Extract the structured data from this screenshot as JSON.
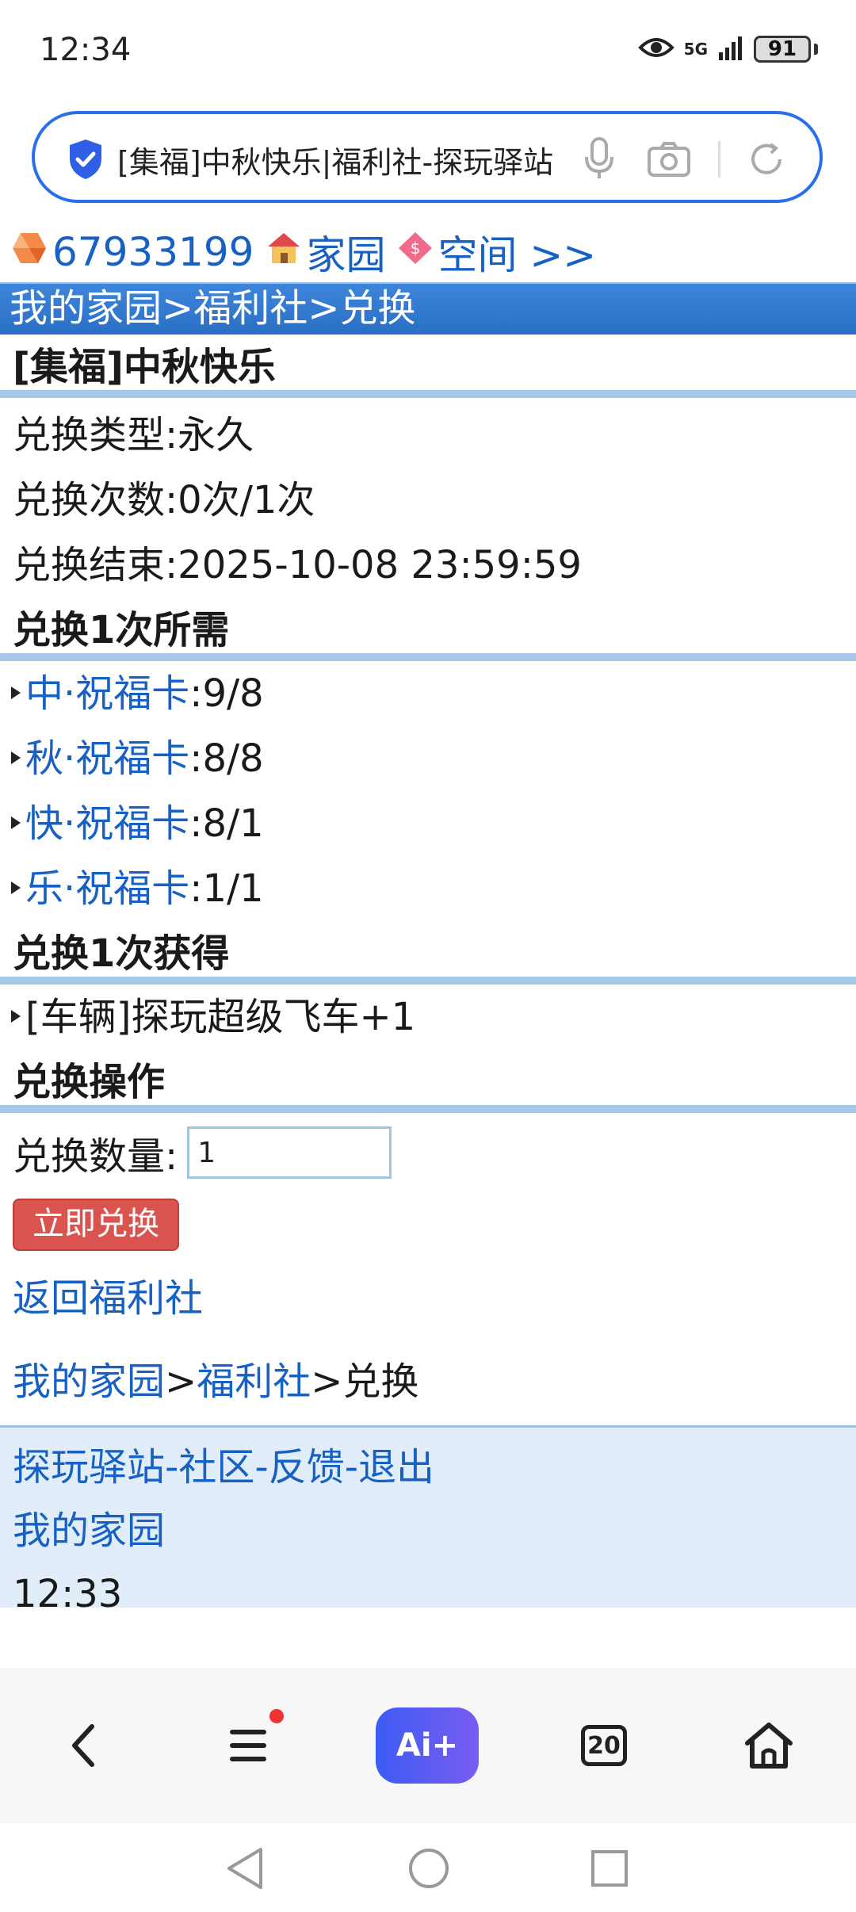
{
  "status_bar": {
    "time": "12:34",
    "network": "5G",
    "battery": "91"
  },
  "address_bar": {
    "url_text": "[集福]中秋快乐|福利社-探玩驿站"
  },
  "top_links": {
    "user_id": "67933199",
    "home": "家园",
    "space": "空间 >>"
  },
  "breadcrumb_top": "我的家园>福利社>兑换",
  "item_title": "[集福]中秋快乐",
  "info": {
    "type": "兑换类型:永久",
    "count": "兑换次数:0次/1次",
    "end": "兑换结束:2025-10-08 23:59:59"
  },
  "requirements": {
    "title": "兑换1次所需",
    "items": [
      {
        "name": "中·祝福卡",
        "value": ":9/8"
      },
      {
        "name": "秋·祝福卡",
        "value": ":8/8"
      },
      {
        "name": "快·祝福卡",
        "value": ":8/1"
      },
      {
        "name": "乐·祝福卡",
        "value": ":1/1"
      }
    ]
  },
  "rewards": {
    "title": "兑换1次获得",
    "items": [
      "[车辆]探玩超级飞车+1"
    ]
  },
  "operation": {
    "title": "兑换操作",
    "qty_label": "兑换数量:",
    "qty_value": "1",
    "submit_label": "立即兑换"
  },
  "back_link": "返回福利社",
  "breadcrumb_bottom": {
    "home": "我的家园",
    "sep1": ">",
    "welfare": "福利社",
    "sep2": ">",
    "current": "兑换"
  },
  "footer": {
    "links": [
      "探玩驿站",
      "社区",
      "反馈",
      "退出"
    ],
    "sep": "-",
    "home_link": "我的家园",
    "time": "12:33"
  },
  "toolbar": {
    "ai_label": "Ai+",
    "tab_count": "20"
  },
  "colors": {
    "accent": "#2a6ef0",
    "link": "#1760c4",
    "button": "#d9534f",
    "footer_bg": "#e1edf9"
  }
}
